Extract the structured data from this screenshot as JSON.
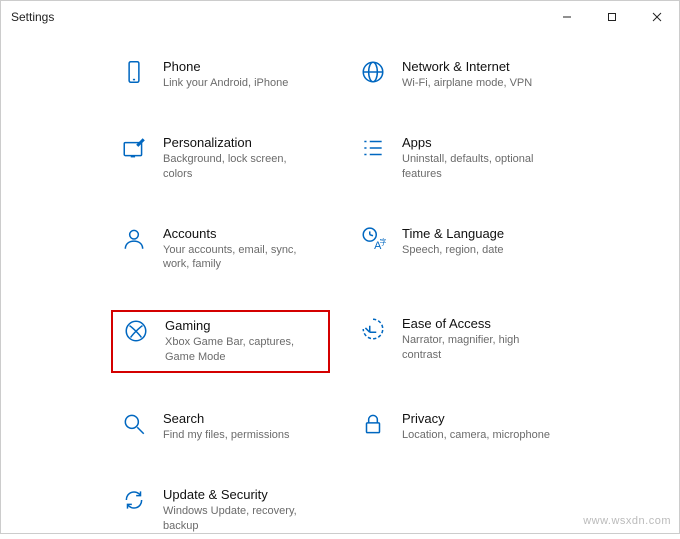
{
  "window": {
    "title": "Settings"
  },
  "categories": [
    {
      "key": "phone",
      "title": "Phone",
      "desc": "Link your Android, iPhone"
    },
    {
      "key": "network",
      "title": "Network & Internet",
      "desc": "Wi-Fi, airplane mode, VPN"
    },
    {
      "key": "personal",
      "title": "Personalization",
      "desc": "Background, lock screen, colors"
    },
    {
      "key": "apps",
      "title": "Apps",
      "desc": "Uninstall, defaults, optional features"
    },
    {
      "key": "accounts",
      "title": "Accounts",
      "desc": "Your accounts, email, sync, work, family"
    },
    {
      "key": "time",
      "title": "Time & Language",
      "desc": "Speech, region, date"
    },
    {
      "key": "gaming",
      "title": "Gaming",
      "desc": "Xbox Game Bar, captures, Game Mode",
      "highlighted": true
    },
    {
      "key": "ease",
      "title": "Ease of Access",
      "desc": "Narrator, magnifier, high contrast"
    },
    {
      "key": "search",
      "title": "Search",
      "desc": "Find my files, permissions"
    },
    {
      "key": "privacy",
      "title": "Privacy",
      "desc": "Location, camera, microphone"
    },
    {
      "key": "update",
      "title": "Update & Security",
      "desc": "Windows Update, recovery, backup"
    }
  ],
  "watermark": "www.wsxdn.com"
}
